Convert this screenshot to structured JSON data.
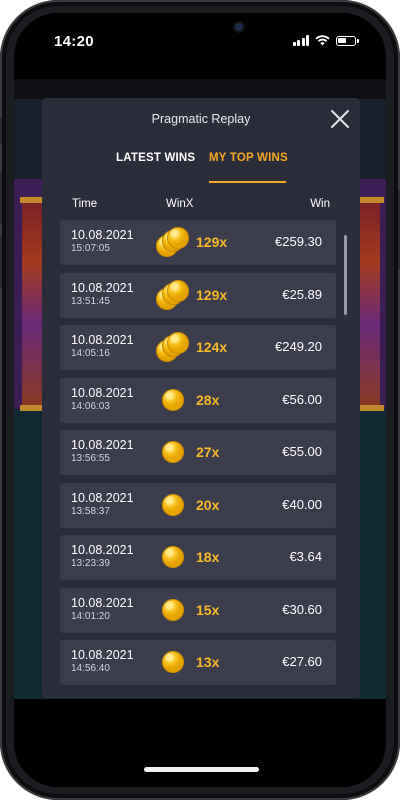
{
  "status_bar": {
    "time": "14:20"
  },
  "modal": {
    "title": "Pragmatic Replay",
    "tabs": [
      {
        "label": "LATEST WINS",
        "active": false
      },
      {
        "label": "MY TOP WINS",
        "active": true
      }
    ],
    "columns": {
      "time": "Time",
      "winx": "WinX",
      "win": "Win"
    },
    "rows": [
      {
        "date": "10.08.2021",
        "time": "15:07:05",
        "mult": "129x",
        "amount": "€259.30",
        "coins": 3
      },
      {
        "date": "10.08.2021",
        "time": "13:51:45",
        "mult": "129x",
        "amount": "€25.89",
        "coins": 3
      },
      {
        "date": "10.08.2021",
        "time": "14:05:16",
        "mult": "124x",
        "amount": "€249.20",
        "coins": 3
      },
      {
        "date": "10.08.2021",
        "time": "14:06:03",
        "mult": "28x",
        "amount": "€56.00",
        "coins": 1
      },
      {
        "date": "10.08.2021",
        "time": "13:56:55",
        "mult": "27x",
        "amount": "€55.00",
        "coins": 1
      },
      {
        "date": "10.08.2021",
        "time": "13:58:37",
        "mult": "20x",
        "amount": "€40.00",
        "coins": 1
      },
      {
        "date": "10.08.2021",
        "time": "13:23:39",
        "mult": "18x",
        "amount": "€3.64",
        "coins": 1
      },
      {
        "date": "10.08.2021",
        "time": "14:01:20",
        "mult": "15x",
        "amount": "€30.60",
        "coins": 1
      },
      {
        "date": "10.08.2021",
        "time": "14:56:40",
        "mult": "13x",
        "amount": "€27.60",
        "coins": 1
      }
    ]
  },
  "colors": {
    "accent": "#f7a823",
    "modal_bg": "#2c2d3a",
    "row_bg": "#3c3d4c",
    "multiplier": "#f7b928"
  },
  "icons": {
    "close": "close-icon",
    "coin": "gold-coin-icon",
    "signal": "cellular-signal-icon",
    "wifi": "wifi-icon",
    "battery": "battery-icon"
  }
}
